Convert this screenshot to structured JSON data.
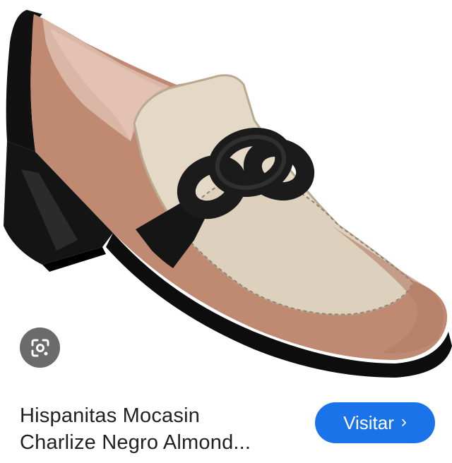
{
  "image": {
    "alt": "Hispanitas Mocasin Charlize Negro Almond"
  },
  "lens": {
    "icon": "google-lens-icon",
    "color": "#6b6b6b"
  },
  "result": {
    "title_line1": "Hispanitas Mocasin",
    "title_line2": "Charlize Negro Almond..."
  },
  "visit": {
    "label": "Visitar",
    "chevron": "›",
    "color": "#1a73e8"
  }
}
